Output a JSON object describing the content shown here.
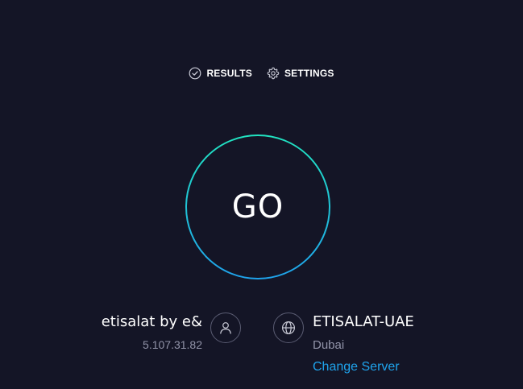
{
  "nav": {
    "results_label": "RESULTS",
    "results_icon": "check-circle-icon",
    "settings_label": "SETTINGS",
    "settings_icon": "gear-icon"
  },
  "go_button": {
    "label": "GO"
  },
  "isp": {
    "name": "etisalat by e&",
    "ip": "5.107.31.82",
    "icon": "user-icon"
  },
  "server": {
    "name": "ETISALAT-UAE",
    "location": "Dubai",
    "change_label": "Change Server",
    "icon": "globe-icon"
  },
  "colors": {
    "background": "#141526",
    "ring_start": "#21e4c1",
    "ring_end": "#1fa3ec",
    "link": "#1fa3ec",
    "muted_text": "#9193a8"
  }
}
